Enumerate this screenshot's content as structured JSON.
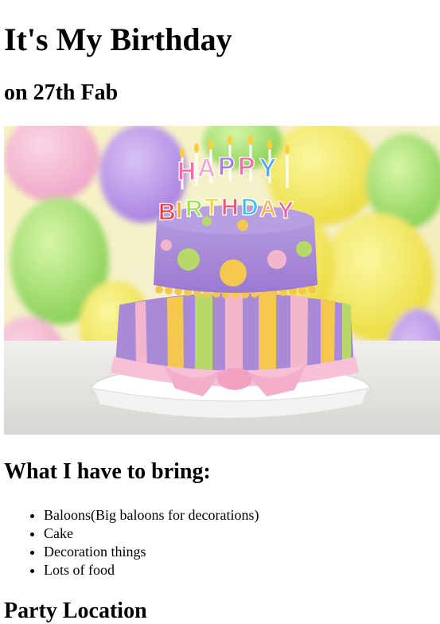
{
  "page": {
    "title": "It's My Birthday",
    "subtitle": "on 27th Fab"
  },
  "hero_image": {
    "icon": "birthday-cake-image",
    "cake_letters": [
      "H",
      "A",
      "P",
      "P",
      "Y",
      "B",
      "I",
      "R",
      "T",
      "H",
      "D",
      "A",
      "Y"
    ],
    "colors": {
      "cake_purple": "#a98ad6",
      "cake_yellow": "#f4c84f",
      "cake_green": "#b6d96a",
      "cake_pink": "#f3b6cc",
      "balloon_yellow": "#f3ea5a",
      "balloon_purple": "#b593e6",
      "balloon_green": "#9fe070"
    }
  },
  "bring": {
    "heading": "What I have to bring:",
    "items": [
      "Baloons(Big baloons for decorations)",
      "Cake",
      "Decoration things",
      "Lots of food"
    ]
  },
  "location": {
    "heading": "Party Location"
  }
}
